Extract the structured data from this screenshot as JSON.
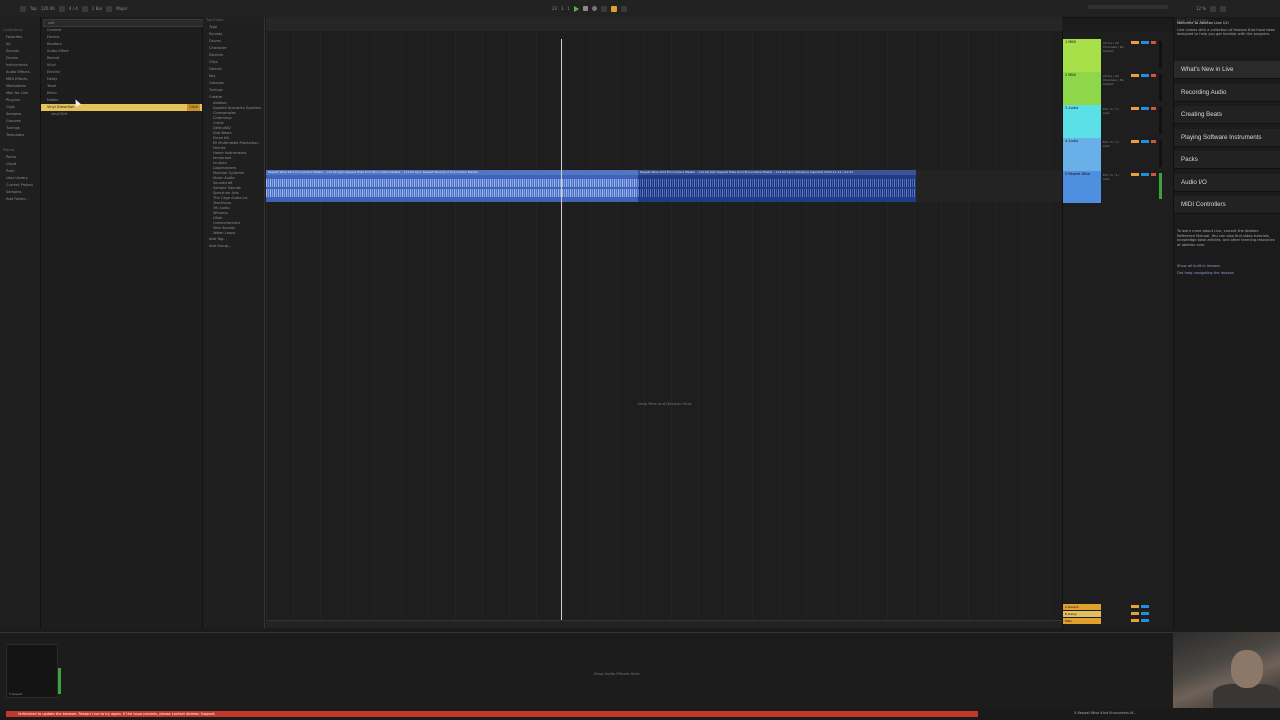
{
  "transport": {
    "tap": "Tap",
    "tempo": "120.00",
    "meter": "4 / 4",
    "quantize": "1 Bar",
    "position": "23 . 3 . 1",
    "key": "Major",
    "cpu": "12 %"
  },
  "browser": {
    "search": "uoE",
    "places_header": "Collections",
    "places": [
      "Favorites",
      "All",
      "Sounds",
      "Drums",
      "Instruments",
      "Audio Effects",
      "MIDI Effects",
      "Modulators",
      "Max for Live",
      "Plug-ins",
      "Clips",
      "Samples",
      "Grooves",
      "Tunings",
      "Templates"
    ],
    "places2_header": "Places",
    "places2": [
      "Packs",
      "Cloud",
      "Push",
      "User Library",
      "Current Project",
      "Samples",
      "Add Folder..."
    ],
    "content_items": [
      "Content",
      "Device",
      "Random",
      "Audio Effect",
      "Record",
      "Vinyl",
      "Electric",
      "Delay",
      "Tonal",
      "Retro",
      "Nodes"
    ],
    "selected_item": "Vinyl Distortion",
    "selected_badge": "Click",
    "sub_item": "vinyl/Grit"
  },
  "filters": {
    "header": "Tag Editor",
    "groups": [
      "Type",
      "Sounds",
      "Drums",
      "Character",
      "Devices",
      "Clips",
      "Genres",
      "Key",
      "Grooves",
      "Tunings",
      "Creator"
    ],
    "creators": [
      "Ableton",
      "Applied Acoustics Systems",
      "Cinesamples",
      "Chromeup",
      "Crank",
      "DefaultAV",
      "Dub Beats",
      "Drum Kit",
      "Ell Multimedia Production",
      "Fennec",
      "Home Instruments",
      "Immersed",
      "Inurban",
      "Loopmasters",
      "Modular Systems",
      "Music Audio",
      "Soundcraft",
      "Sample Sounds",
      "Spectrum Arts",
      "The Cage Audio Inc",
      "Touchloop",
      "Trk Audio",
      "Winamp",
      "Uhoh",
      "Unmechanized",
      "Vibe Sounds",
      "Water Loops"
    ],
    "add_tag": "Add Tag...",
    "add_group": "Add Group..."
  },
  "arrangement": {
    "clip_a_name": "Repeat Wise Kind Encounters Master - 112.00 bpm  Repeat Wise Kind Encounters Master - 112.00 bpm  Repeat Wise Kind Encounters Master",
    "clip_b_name": "Repeat Wise Kind Encounters Master - 112.00 bpm  Repeat Wise Kind Encounters Master - 112.00 bpm (Variance Inspired)  2025-11-11  / 01:41",
    "drop_hint": "Drop Files and Devices Here"
  },
  "tracks": [
    {
      "name": "1 MIDI",
      "io": "All Ins / All Channels / No Output",
      "color": "#a8e04a"
    },
    {
      "name": "2 MIDI",
      "io": "All Ins / All Channels / No Output",
      "color": "#8ed64a"
    },
    {
      "name": "3 Audio",
      "io": "Ext. In / 1 / Auto",
      "color": "#5ae0e6"
    },
    {
      "name": "4 Audio",
      "io": "Ext. In / 1 / Auto",
      "color": "#6ab0e8"
    },
    {
      "name": "5 Repeat Wise",
      "io": "Ext. In / 1 / Auto",
      "color": "#4f8fe0"
    }
  ],
  "returns": [
    {
      "name": "A Reverb",
      "color": "#e0a030"
    },
    {
      "name": "B Delay",
      "color": "#e0c060"
    },
    {
      "name": "Main",
      "color": "#e0a030"
    }
  ],
  "lessons": {
    "tab": "Live 12 Lessons",
    "intro_title": "Welcome to Ableton Live 12!",
    "intro": "Live comes with a collection of lessons that have been designed to help you get familiar with the program.",
    "items": [
      "What's New in Live",
      "Recording Audio",
      "Creating Beats",
      "Playing Software Instruments",
      "Packs",
      "Audio I/O",
      "MIDI Controllers"
    ],
    "body": "To learn more about Live, consult the Ableton Reference Manual. You can also find video tutorials, knowledge base articles, and other learning resources at ableton.com.",
    "link1": "Show all built-in lessons",
    "link2": "Get help navigating the lessons"
  },
  "detail": {
    "drop_hint": "Drop Audio Effects Here",
    "clip_label": "5-Repeat"
  },
  "status": {
    "message": "Unfinished to update the browser. Restart Live to try again. If the issue persists, please contact Ableton Support.",
    "right": "5-Repeat Wise Kind Encounters M..."
  }
}
